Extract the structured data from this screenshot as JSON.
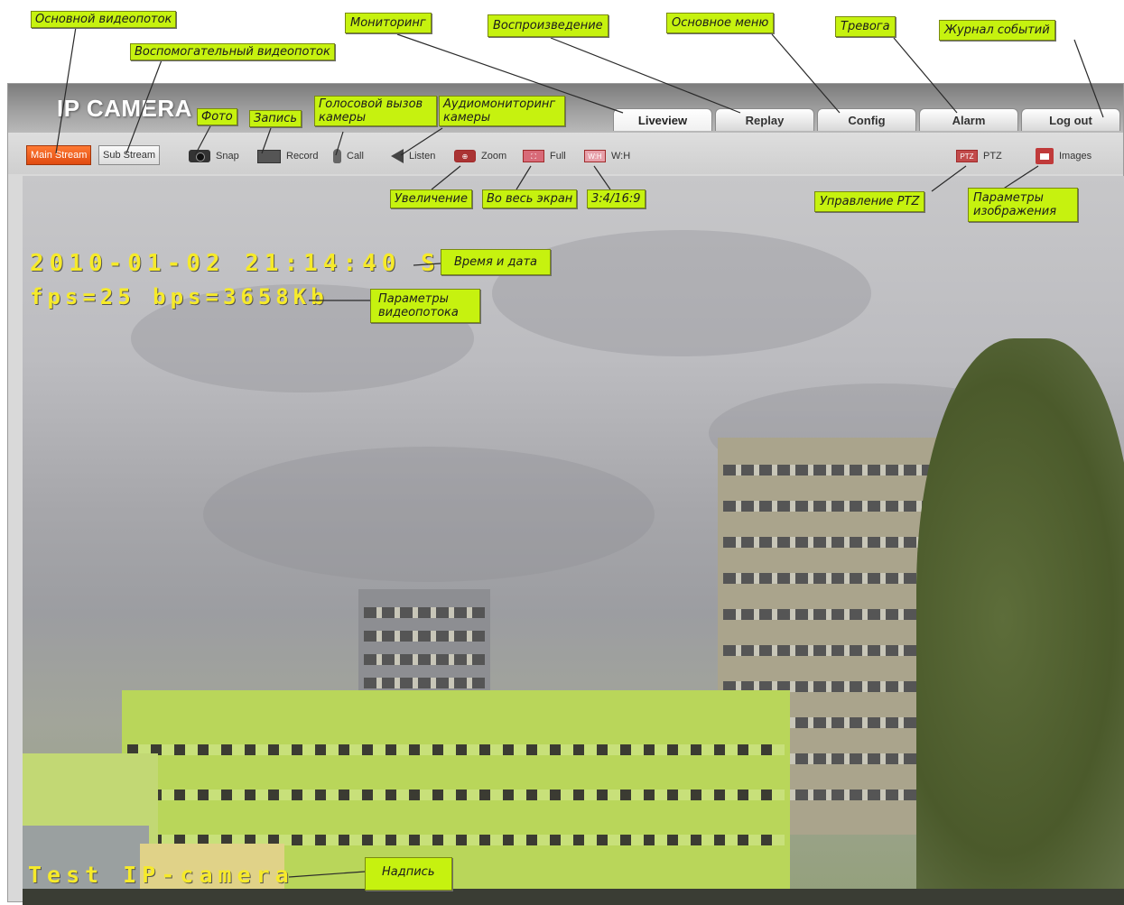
{
  "app": {
    "brand": "IP CAMERA",
    "tabs": [
      {
        "label": "Liveview",
        "active": true
      },
      {
        "label": "Replay",
        "active": false
      },
      {
        "label": "Config",
        "active": false
      },
      {
        "label": "Alarm",
        "active": false
      },
      {
        "label": "Log out",
        "active": false
      }
    ]
  },
  "toolbar": {
    "main_stream": "Main Stream",
    "sub_stream": "Sub Stream",
    "snap": "Snap",
    "record": "Record",
    "call": "Call",
    "listen": "Listen",
    "zoom": "Zoom",
    "full": "Full",
    "wh_icon": "W:H",
    "wh": "W:H",
    "ptz_icon": "PTZ",
    "ptz": "PTZ",
    "images": "Images"
  },
  "osd": {
    "datetime": "2010-01-02 21:14:40 SAT",
    "stream_info": "fps=25 bps=3658Kb",
    "caption": "Test IP-camera"
  },
  "callouts": {
    "main_stream": "Основной видеопоток",
    "sub_stream": "Воспомогательный видеопоток",
    "monitoring": "Мониторинг",
    "playback": "Воспроизведение",
    "main_menu": "Основное меню",
    "alarm": "Тревога",
    "event_log": "Журнал событий",
    "photo": "Фото",
    "record": "Запись",
    "voice_call": "Голосовой вызов камеры",
    "audio_monitoring": "Аудиомониторинг камеры",
    "zoom": "Увеличение",
    "fullscreen": "Во весь экран",
    "aspect": "3:4/16:9",
    "ptz": "Управление PTZ",
    "image_params": "Параметры изображения",
    "datetime": "Время и дата",
    "stream_params": "Параметры видеопотока",
    "caption": "Надпись"
  },
  "colors": {
    "callout_bg": "#c6f20f",
    "osd_text": "#f6ea2a",
    "main_stream_active": "#e85a1a"
  }
}
